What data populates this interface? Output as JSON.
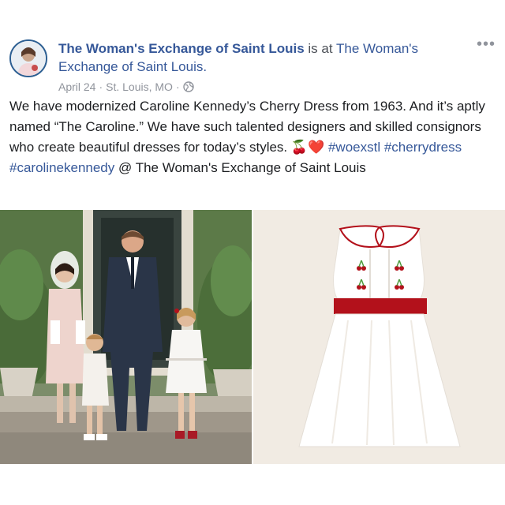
{
  "post": {
    "page_name": "The Woman's Exchange of Saint Louis",
    "is_at": "is at",
    "place": "The Woman's Exchange of Saint Louis.",
    "date": "April 24",
    "location": "St. Louis, MO",
    "separator": "·",
    "more_label": "•••",
    "body_text": "We have modernized Caroline Kennedy’s Cherry Dress from 1963. And it’s aptly named “The Caroline.” We have such talented designers and skilled consignors who create beautiful dresses for today’s styles.",
    "emoji": "🍒❤️",
    "hashtag_1": "#woexstl",
    "hashtag_2": "#cherrydress",
    "hashtag_3": "#carolinekennedy",
    "mention_at": "@",
    "mention": "The Woman's Exchange of Saint Louis"
  },
  "icons": {
    "globe": "globe-icon",
    "more": "more-options-icon"
  },
  "colors": {
    "link_blue": "#365899",
    "meta_grey": "#90949c",
    "dress_red": "#b3111b"
  }
}
